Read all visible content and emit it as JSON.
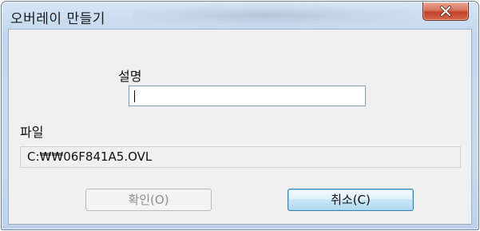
{
  "window": {
    "title": "오버레이 만들기"
  },
  "form": {
    "description_label": "설명",
    "description_value": "",
    "file_label": "파일",
    "file_path": "C:₩₩06F841A5.OVL"
  },
  "buttons": {
    "ok_label": "확인(O)",
    "ok_enabled": false,
    "cancel_label": "취소(C)"
  },
  "icons": {
    "close": "close-icon"
  },
  "colors": {
    "close_button": "#c7432b",
    "focus_border": "#3c7fb1",
    "disabled_text": "#8d8d8d"
  }
}
